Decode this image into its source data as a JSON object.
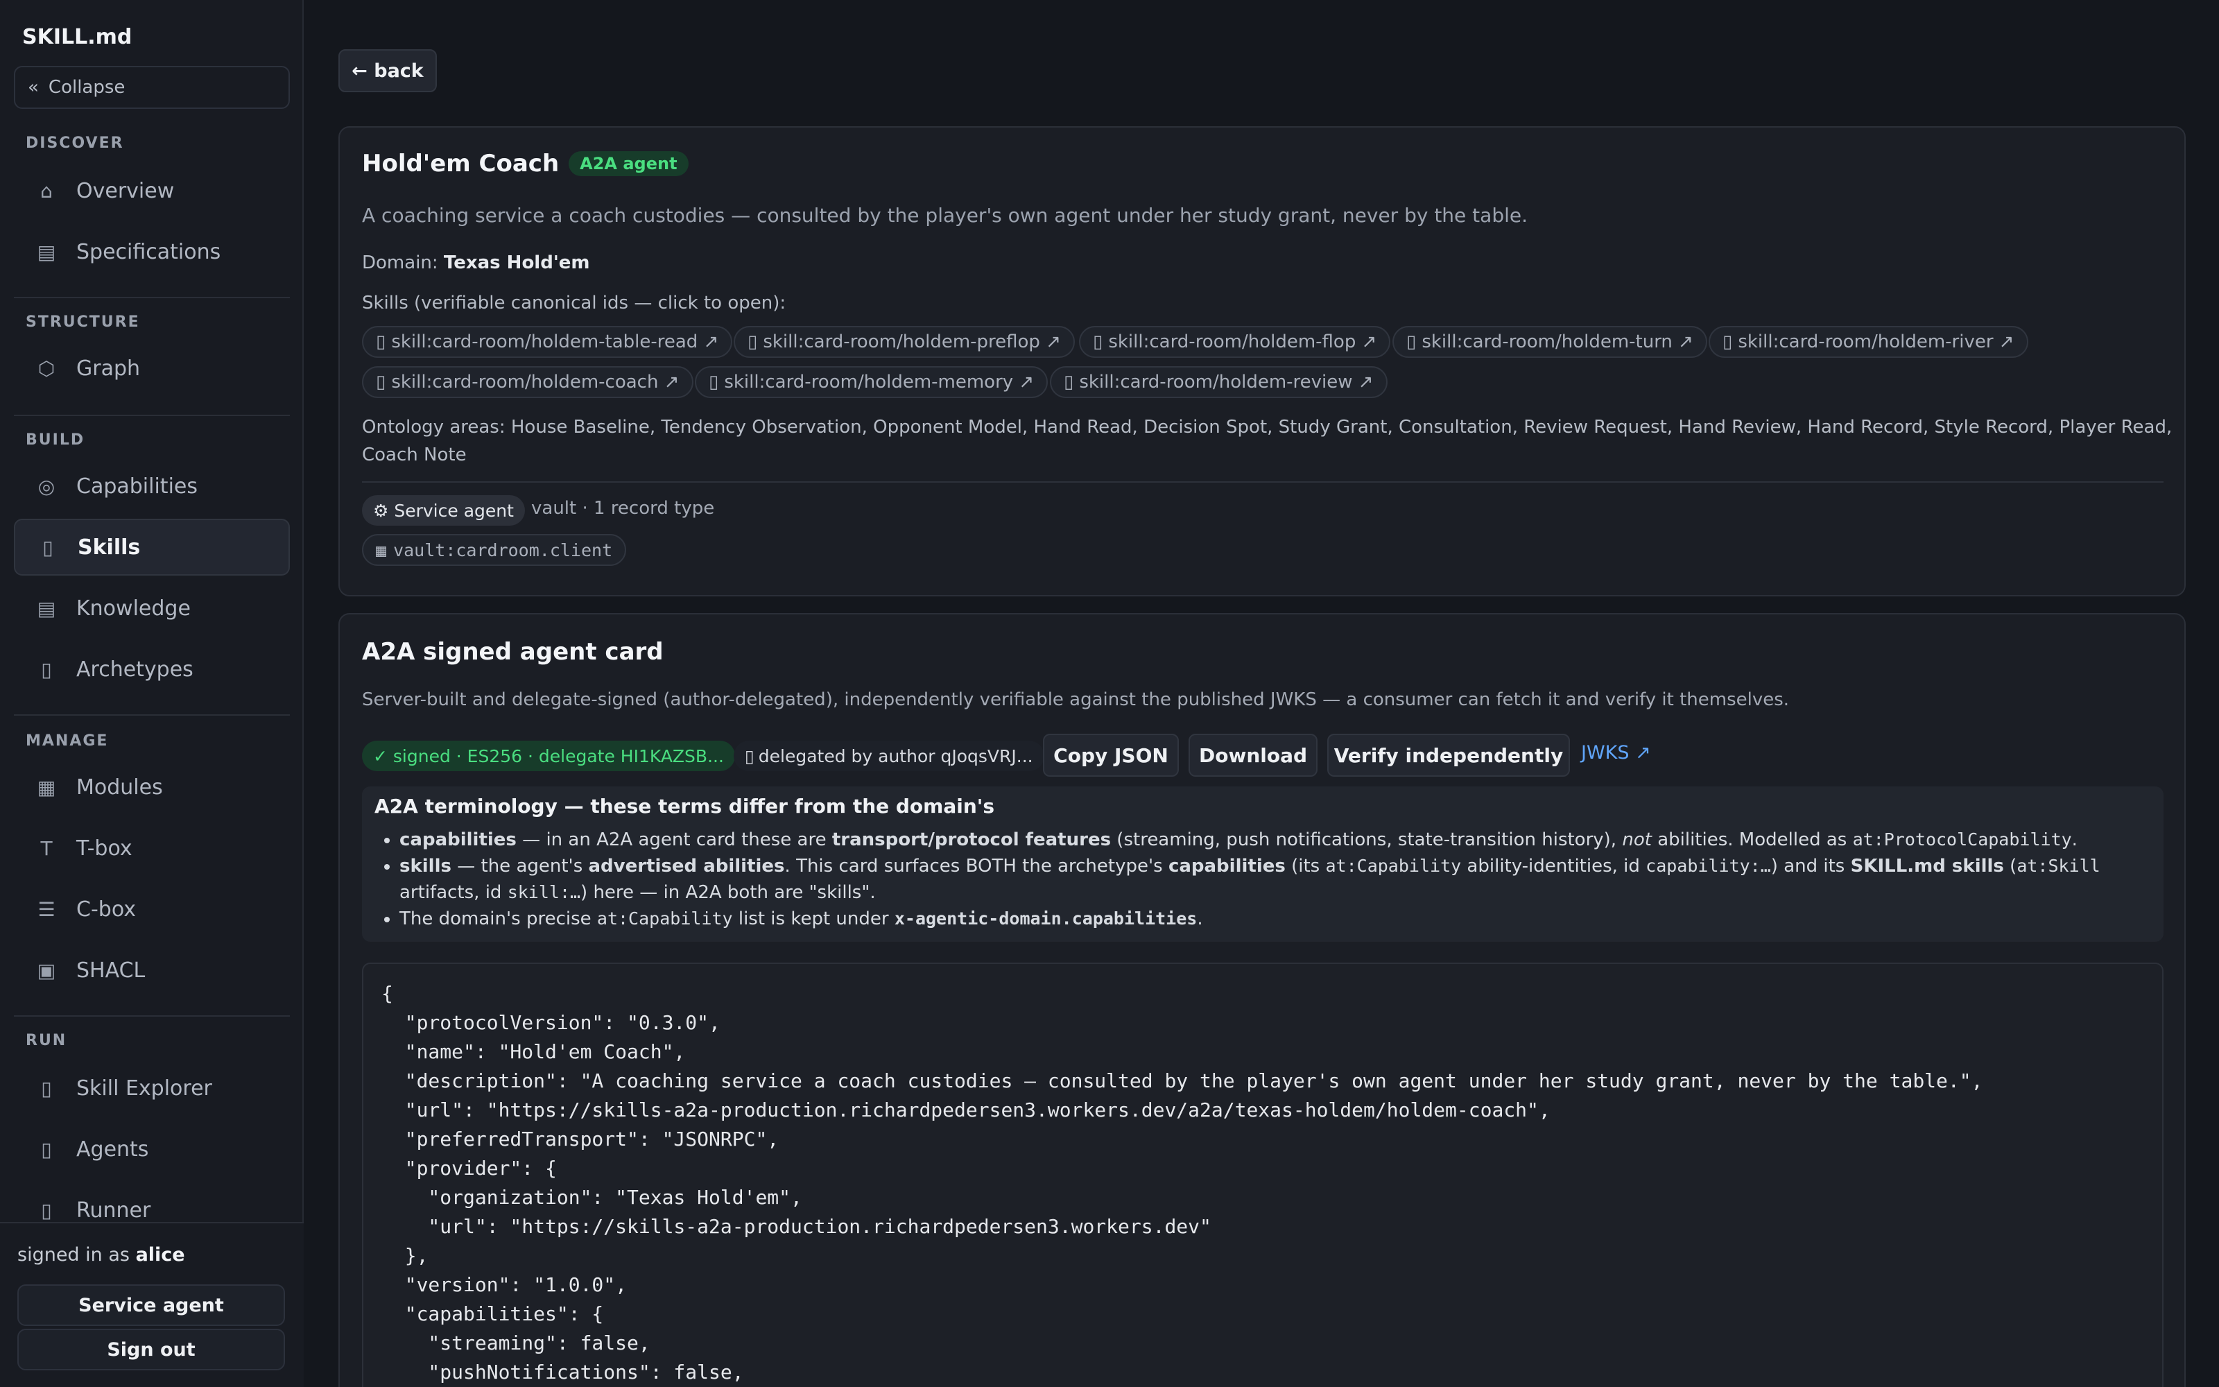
{
  "sidebar": {
    "brand": "SKILL.md",
    "collapse_label": "Collapse",
    "collapse_glyph": "«",
    "sections": {
      "discover": "DISCOVER",
      "structure": "STRUCTURE",
      "build": "BUILD",
      "manage": "MANAGE",
      "run": "RUN"
    },
    "items": {
      "overview": {
        "label": "Overview",
        "icon": "⌂"
      },
      "specifications": {
        "label": "Specifications",
        "icon": "▤"
      },
      "graph": {
        "label": "Graph",
        "icon": "⬡"
      },
      "capabilities": {
        "label": "Capabilities",
        "icon": "◎"
      },
      "skills": {
        "label": "Skills",
        "icon": "▯"
      },
      "knowledge": {
        "label": "Knowledge",
        "icon": "▤"
      },
      "archetypes": {
        "label": "Archetypes",
        "icon": "▯"
      },
      "modules": {
        "label": "Modules",
        "icon": "▦"
      },
      "tbox": {
        "label": "T-box",
        "icon": "T"
      },
      "cbox": {
        "label": "C-box",
        "icon": "☰"
      },
      "shacl": {
        "label": "SHACL",
        "icon": "▣"
      },
      "skill_explorer": {
        "label": "Skill Explorer",
        "icon": "▯"
      },
      "agents": {
        "label": "Agents",
        "icon": "▯"
      },
      "runner": {
        "label": "Runner",
        "icon": "▯"
      }
    },
    "footer": {
      "signed_in_prefix": "signed in as",
      "username": "alice",
      "service_agent_label": "Service agent",
      "sign_out_label": "Sign out"
    }
  },
  "back_label": "← back",
  "agent": {
    "name": "Hold'em Coach",
    "badge": "A2A agent",
    "description": "A coaching service a coach custodies — consulted by the player's own agent under her study grant, never by the table.",
    "domain_label": "Domain:",
    "domain_value": "Texas Hold'em",
    "skills_heading": "Skills (verifiable canonical ids — click to open):",
    "skill_glyph": "▯",
    "skills": [
      "skill:card-room/holdem-table-read ↗",
      "skill:card-room/holdem-preflop ↗",
      "skill:card-room/holdem-flop ↗",
      "skill:card-room/holdem-turn ↗",
      "skill:card-room/holdem-river ↗",
      "skill:card-room/holdem-coach ↗",
      "skill:card-room/holdem-memory ↗",
      "skill:card-room/holdem-review ↗"
    ],
    "ontology_line1": "Ontology areas: House Baseline, Tendency Observation, Opponent Model, Hand Read, Decision Spot, Study Grant, Consultation, Review Request, Hand Review, Hand Record, Style Record, Player Read,",
    "ontology_line2": "Coach Note",
    "service_badge": "⚙ Service agent",
    "vault_summary": "vault · 1 record type",
    "vault_glyph": "▦",
    "vault_id": "vault:cardroom.client"
  },
  "card": {
    "title": "A2A signed agent card",
    "subtitle": "Server-built and delegate-signed (author-delegated), independently verifiable against the published JWKS — a consumer can fetch it and verify it themselves.",
    "signed_badge": "✓ signed · ES256 · delegate HI1KAZSB...",
    "delegated_glyph": "▯",
    "delegated_badge": "delegated by author qJoqsVRJ...",
    "copy_json": "Copy JSON",
    "download": "Download",
    "verify": "Verify independently",
    "jwks_link": "JWKS ↗",
    "terminology": {
      "heading": "A2A terminology — these terms differ from the domain's",
      "b1_term": "capabilities",
      "b1_mid": " — in an A2A agent card these are ",
      "b1_strong": "transport/protocol features",
      "b1_paren": " (streaming, push notifications, state-transition history), ",
      "b1_em": "not",
      "b1_tail": " abilities. Modelled as ",
      "b1_code": "at:ProtocolCapability",
      "b1_end": ".",
      "b2_term": "skills",
      "b2_mid": " — the agent's ",
      "b2_strong1": "advertised abilities",
      "b2_a": ". This card surfaces BOTH the archetype's ",
      "b2_strong2": "capabilities",
      "b2_b": " (its ",
      "b2_code1": "at:Capability",
      "b2_c": " ability-identities, id ",
      "b2_code2": "capability:…",
      "b2_d": ") and its ",
      "b2_strong3": "SKILL.md skills",
      "b2_e": " (",
      "b2_code3": "at:Skill",
      "b2_f": "artifacts, id ",
      "b2_code4": "skill:…",
      "b2_g": ") here — in A2A both are \"skills\".",
      "b3_a": "The domain's precise ",
      "b3_code1": "at:Capability",
      "b3_b": " list is kept under ",
      "b3_code2": "x-agentic-domain.capabilities",
      "b3_end": "."
    },
    "json_text": "{\n  \"protocolVersion\": \"0.3.0\",\n  \"name\": \"Hold'em Coach\",\n  \"description\": \"A coaching service a coach custodies — consulted by the player's own agent under her study grant, never by the table.\",\n  \"url\": \"https://skills-a2a-production.richardpedersen3.workers.dev/a2a/texas-holdem/holdem-coach\",\n  \"preferredTransport\": \"JSONRPC\",\n  \"provider\": {\n    \"organization\": \"Texas Hold'em\",\n    \"url\": \"https://skills-a2a-production.richardpedersen3.workers.dev\"\n  },\n  \"version\": \"1.0.0\",\n  \"capabilities\": {\n    \"streaming\": false,\n    \"pushNotifications\": false,"
  }
}
